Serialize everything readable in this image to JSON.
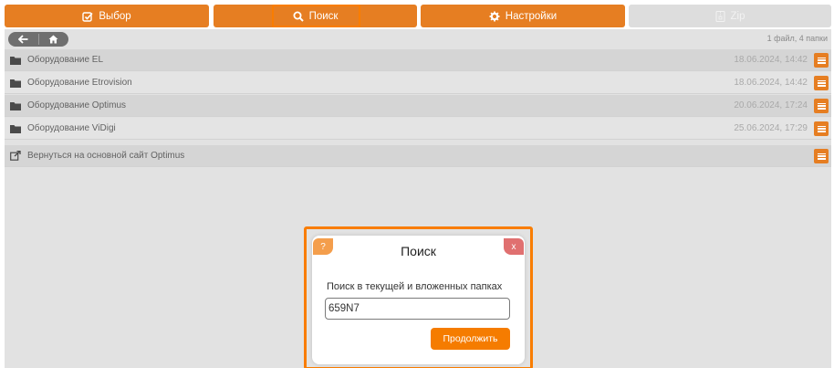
{
  "tabs": {
    "select": "Выбор",
    "search": "Поиск",
    "settings": "Настройки",
    "zip": "Zip"
  },
  "file_count": "1 файл, 4 папки",
  "items": [
    {
      "name": "Оборудование EL",
      "date": "18.06.2024, 14:42",
      "icon": "folder-icon"
    },
    {
      "name": "Оборудование Etrovision",
      "date": "18.06.2024, 14:42",
      "icon": "folder-icon"
    },
    {
      "name": "Оборудование Optimus",
      "date": "20.06.2024, 17:24",
      "icon": "folder-icon"
    },
    {
      "name": "Оборудование ViDigi",
      "date": "25.06.2024, 17:29",
      "icon": "folder-icon"
    },
    {
      "name": "Вернуться на основной сайт Optimus",
      "date": "",
      "icon": "external-link-icon"
    }
  ],
  "dialog": {
    "help": "?",
    "close": "x",
    "title": "Поиск",
    "label": "Поиск в текущей и вложенных папках",
    "input_value": "659N7",
    "submit": "Продолжить"
  },
  "colors": {
    "accent": "#e67e22",
    "highlight": "#f97d00",
    "disabled_tab": "#dddddd",
    "content_bg": "#e2e2e2"
  }
}
